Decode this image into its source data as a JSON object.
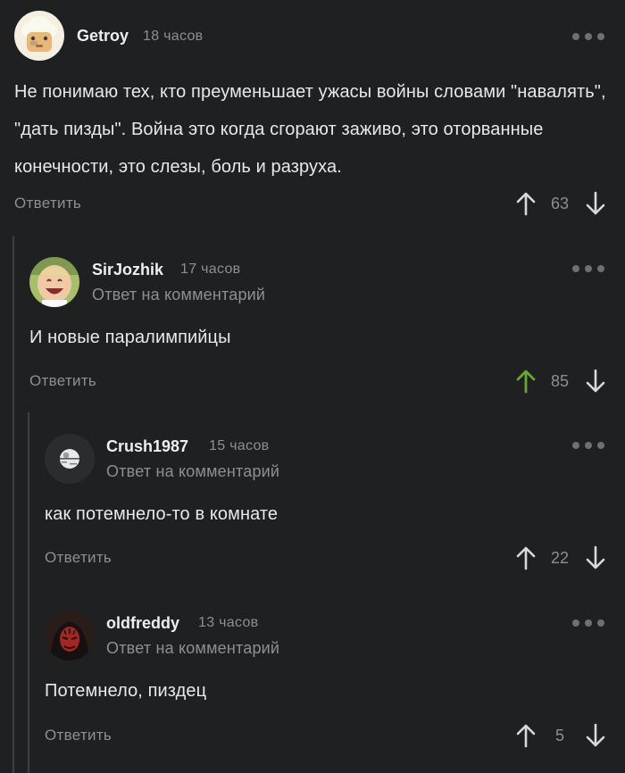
{
  "comments": [
    {
      "username": "Getroy",
      "time": "18 часов",
      "reply_to": "",
      "text": "Не понимаю тех, кто преуменьшает ужасы войны словами \"навалять\", \"дать пизды\". Война это когда сгорают заживо, это оторванные конечности, это слезы, боль и разруха.",
      "reply_label": "Ответить",
      "score": "63",
      "upvoted": false
    },
    {
      "username": "SirJozhik",
      "time": "17 часов",
      "reply_to": "Ответ на комментарий",
      "text": "И новые паралимпийцы",
      "reply_label": "Ответить",
      "score": "85",
      "upvoted": true
    },
    {
      "username": "Crush1987",
      "time": "15 часов",
      "reply_to": "Ответ на комментарий",
      "text": "как потемнело-то в комнате",
      "reply_label": "Ответить",
      "score": "22",
      "upvoted": false
    },
    {
      "username": "oldfreddy",
      "time": "13 часов",
      "reply_to": "Ответ на комментарий",
      "text": "Потемнело, пиздец",
      "reply_label": "Ответить",
      "score": "5",
      "upvoted": false
    }
  ],
  "colors": {
    "background": "#1f2022",
    "muted": "#8c8f94",
    "upvote_active": "#6aa630",
    "thread_line": "#3d3f43"
  },
  "icons": {
    "upvote": "arrow-up-icon",
    "downvote": "arrow-down-icon",
    "more": "more-dots-icon"
  }
}
